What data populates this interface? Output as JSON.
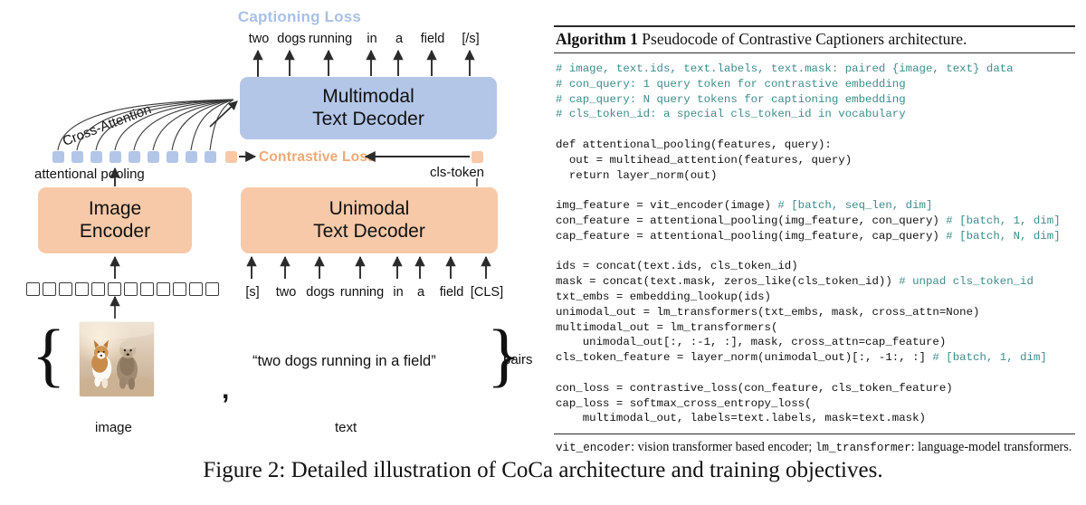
{
  "figure": {
    "caption": "Figure 2: Detailed illustration of CoCa architecture and training objectives."
  },
  "colors": {
    "blue_box": "#b3c6e7",
    "orange_box": "#f7c9a8",
    "captioning_loss_text": "#a9c0e8",
    "contrastive_loss_text": "#f0a875",
    "arrow": "#2b2b2b"
  },
  "diagram": {
    "captioning_loss_label": "Captioning Loss",
    "contrastive_loss_label": "Contrastive Loss",
    "cross_attention_label": "Cross-Attention",
    "attentional_pooling_label": "attentional pooling",
    "cls_token_label": "cls-token",
    "output_tokens": [
      "two",
      "dogs",
      "running",
      "in",
      "a",
      "field",
      "[/s]"
    ],
    "input_tokens": [
      "[s]",
      "two",
      "dogs",
      "running",
      "in",
      "a",
      "field",
      "[CLS]"
    ],
    "multimodal_decoder": {
      "line1": "Multimodal",
      "line2": "Text Decoder"
    },
    "unimodal_decoder": {
      "line1": "Unimodal",
      "line2": "Text Decoder"
    },
    "image_encoder": {
      "line1": "Image",
      "line2": "Encoder"
    },
    "pooling_tokens": {
      "blue_count": 9,
      "orange_count": 1
    },
    "patch_token_count": 12,
    "bottom": {
      "image_label": "image",
      "text_label": "text",
      "pairs_label": "pairs",
      "caption_text": "“two dogs running in a field”",
      "separator": ","
    }
  },
  "algorithm": {
    "title_bold": "Algorithm 1",
    "title_rest": " Pseudocode of Contrastive Captioners architecture.",
    "footnote_parts": {
      "a": "vit_encoder",
      "b": ": vision transformer based encoder; ",
      "c": "lm_transformer",
      "d": ": language-model transformers."
    },
    "code_lines": [
      {
        "t": "comment",
        "text": "# image, text.ids, text.labels, text.mask: paired {image, text} data"
      },
      {
        "t": "comment",
        "text": "# con_query: 1 query token for contrastive embedding"
      },
      {
        "t": "comment",
        "text": "# cap_query: N query tokens for captioning embedding"
      },
      {
        "t": "comment",
        "text": "# cls_token_id: a special cls_token_id in vocabulary"
      },
      {
        "t": "blank",
        "text": ""
      },
      {
        "t": "code",
        "text": "def attentional_pooling(features, query):"
      },
      {
        "t": "code",
        "text": "  out = multihead_attention(features, query)"
      },
      {
        "t": "code",
        "text": "  return layer_norm(out)"
      },
      {
        "t": "blank",
        "text": ""
      },
      {
        "t": "mixed",
        "code": "img_feature = vit_encoder(image) ",
        "comment": "# [batch, seq_len, dim]"
      },
      {
        "t": "mixed",
        "code": "con_feature = attentional_pooling(img_feature, con_query) ",
        "comment": "# [batch, 1, dim]"
      },
      {
        "t": "mixed",
        "code": "cap_feature = attentional_pooling(img_feature, cap_query) ",
        "comment": "# [batch, N, dim]"
      },
      {
        "t": "blank",
        "text": ""
      },
      {
        "t": "code",
        "text": "ids = concat(text.ids, cls_token_id)"
      },
      {
        "t": "mixed",
        "code": "mask = concat(text.mask, zeros_like(cls_token_id)) ",
        "comment": "# unpad cls_token_id"
      },
      {
        "t": "code",
        "text": "txt_embs = embedding_lookup(ids)"
      },
      {
        "t": "code",
        "text": "unimodal_out = lm_transformers(txt_embs, mask, cross_attn=None)"
      },
      {
        "t": "code",
        "text": "multimodal_out = lm_transformers("
      },
      {
        "t": "code",
        "text": "    unimodal_out[:, :-1, :], mask, cross_attn=cap_feature)"
      },
      {
        "t": "mixed",
        "code": "cls_token_feature = layer_norm(unimodal_out)[:, -1:, :] ",
        "comment": "# [batch, 1, dim]"
      },
      {
        "t": "blank",
        "text": ""
      },
      {
        "t": "code",
        "text": "con_loss = contrastive_loss(con_feature, cls_token_feature)"
      },
      {
        "t": "code",
        "text": "cap_loss = softmax_cross_entropy_loss("
      },
      {
        "t": "code",
        "text": "    multimodal_out, labels=text.labels, mask=text.mask)"
      }
    ]
  }
}
